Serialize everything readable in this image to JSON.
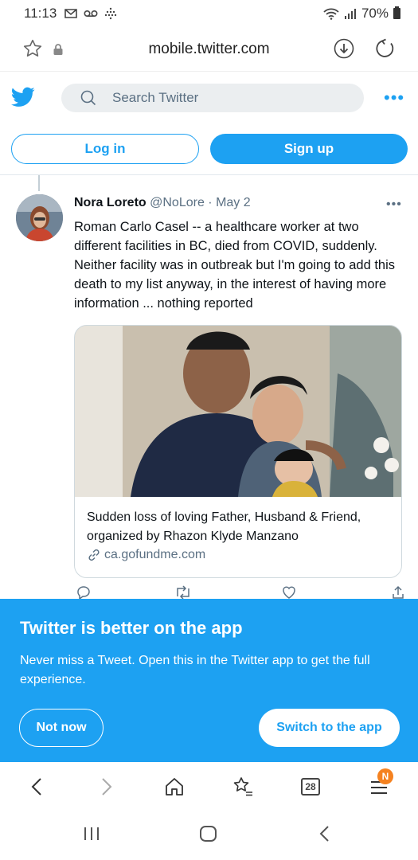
{
  "status_bar": {
    "time": "11:13",
    "battery": "70%"
  },
  "browser": {
    "url": "mobile.twitter.com",
    "tab_count": "28",
    "menu_badge": "N"
  },
  "twitter": {
    "search_placeholder": "Search Twitter",
    "login_label": "Log in",
    "signup_label": "Sign up",
    "accent_color": "#1da1f2"
  },
  "tweet": {
    "author_name": "Nora Loreto",
    "handle": "@NoLore",
    "separator": "·",
    "date": "May 2",
    "text": "Roman Carlo Casel -- a healthcare worker at two different facilities in BC, died from COVID, suddenly. Neither facility was in outbreak but I'm going to add this death to my list anyway, in the interest of having more information ... nothing reported",
    "card": {
      "title": "Sudden loss of loving Father, Husband & Friend, organized by Rhazon Klyde Manzano",
      "domain": "ca.gofundme.com"
    }
  },
  "app_banner": {
    "title": "Twitter is better on the app",
    "text": "Never miss a Tweet. Open this in the Twitter app to get the full experience.",
    "not_now_label": "Not now",
    "switch_label": "Switch to the app"
  }
}
